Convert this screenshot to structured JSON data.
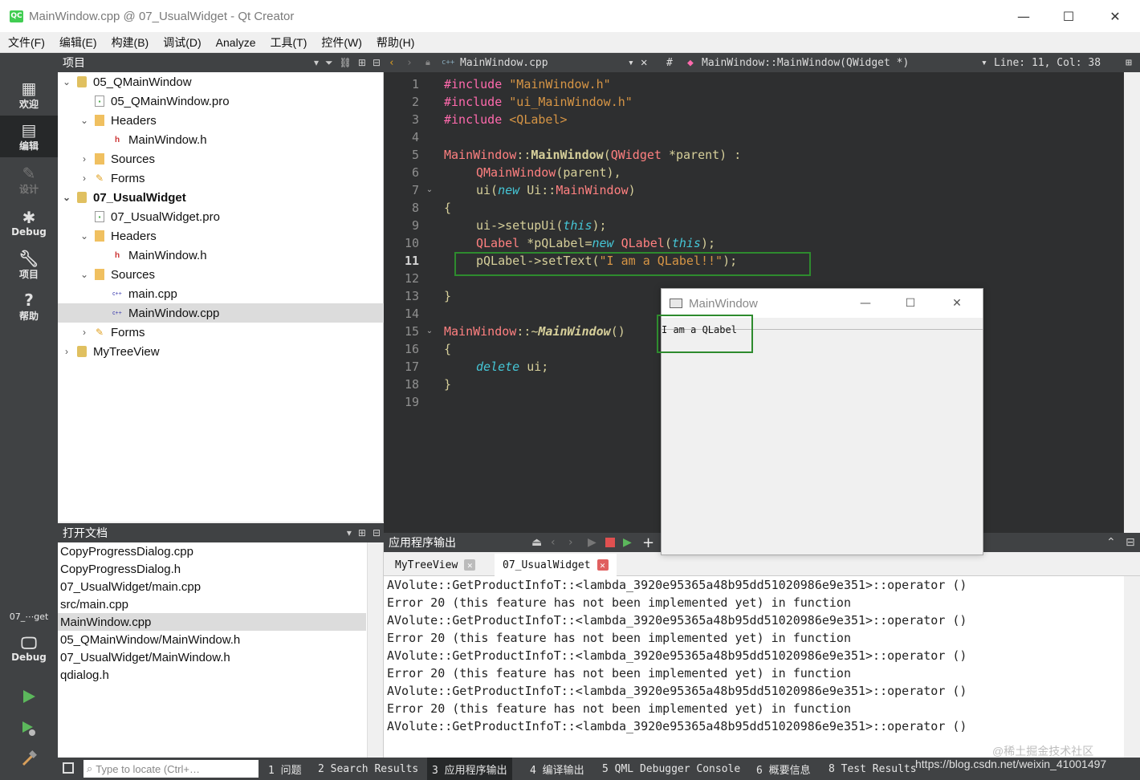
{
  "window": {
    "title": "MainWindow.cpp @ 07_UsualWidget - Qt Creator",
    "app_icon": "QC"
  },
  "menu": [
    "文件(F)",
    "编辑(E)",
    "构建(B)",
    "调试(D)",
    "Analyze",
    "工具(T)",
    "控件(W)",
    "帮助(H)"
  ],
  "modes": {
    "welcome": "欢迎",
    "edit": "编辑",
    "design": "设计",
    "debug": "Debug",
    "projects": "项目",
    "help": "帮助"
  },
  "kit": {
    "target": "07_⋯get",
    "mode": "Debug"
  },
  "projects_pane": {
    "title": "项目"
  },
  "tree": [
    {
      "label": "05_QMainWindow",
      "bold": false
    },
    {
      "label": "05_QMainWindow.pro"
    },
    {
      "label": "Headers"
    },
    {
      "label": "MainWindow.h"
    },
    {
      "label": "Sources"
    },
    {
      "label": "Forms"
    },
    {
      "label": "07_UsualWidget",
      "bold": true
    },
    {
      "label": "07_UsualWidget.pro"
    },
    {
      "label": "Headers"
    },
    {
      "label": "MainWindow.h"
    },
    {
      "label": "Sources"
    },
    {
      "label": "main.cpp"
    },
    {
      "label": "MainWindow.cpp",
      "selected": true
    },
    {
      "label": "Forms"
    },
    {
      "label": "MyTreeView"
    }
  ],
  "open_docs": {
    "title": "打开文档",
    "items": [
      "CopyProgressDialog.cpp",
      "CopyProgressDialog.h",
      "07_UsualWidget/main.cpp",
      "src/main.cpp",
      "MainWindow.cpp",
      "05_QMainWindow/MainWindow.h",
      "07_UsualWidget/MainWindow.h",
      "qdialog.h"
    ]
  },
  "editor_toolbar": {
    "file": "MainWindow.cpp",
    "hash": "#",
    "symbol": "MainWindow::MainWindow(QWidget *)",
    "position": "Line: 11, Col: 38"
  },
  "code_lines": [
    "1",
    "2",
    "3",
    "4",
    "5",
    "6",
    "7",
    "8",
    "9",
    "10",
    "11",
    "12",
    "13",
    "14",
    "15",
    "16",
    "17",
    "18",
    "19"
  ],
  "code": {
    "l1_pre": "#include",
    "l1_str": "\"MainWindow.h\"",
    "l2_pre": "#include",
    "l2_str": "\"ui_MainWindow.h\"",
    "l3_pre": "#include",
    "l3_str": "<QLabel>",
    "l5_cls": "MainWindow",
    "l5_sep": "::",
    "l5_fn": "MainWindow",
    "l5_p1": "(",
    "l5_type": "QWidget",
    "l5_rest": " *parent) :",
    "l6_cls": "QMainWindow",
    "l6_rest": "(parent),",
    "l7_a": "ui(",
    "l7_kw": "new",
    "l7_b": " Ui::",
    "l7_cls": "MainWindow",
    "l7_c": ")",
    "l8": "{",
    "l9_a": "ui->setupUi(",
    "l9_kw": "this",
    "l9_b": ");",
    "l10_cls": "QLabel",
    "l10_a": " *pQLabel=",
    "l10_kw": "new",
    "l10_cls2": " QLabel",
    "l10_b": "(",
    "l10_kw2": "this",
    "l10_c": ");",
    "l11_a": "pQLabel->setText(",
    "l11_str": "\"I am a QLabel!!\"",
    "l11_b": ");",
    "l13": "}",
    "l15_cls": "MainWindow",
    "l15_sep": "::~",
    "l15_fn": "MainWindow",
    "l15_rest": "()",
    "l16": "{",
    "l17_kw": "delete",
    "l17_rest": " ui;",
    "l18": "}"
  },
  "app_window": {
    "title": "MainWindow",
    "label": "I am a QLabel"
  },
  "output": {
    "title": "应用程序输出",
    "tabs": [
      {
        "label": "MyTreeView"
      },
      {
        "label": "07_UsualWidget"
      }
    ],
    "lines": [
      "AVolute::GetProductInfoT::<lambda_3920e95365a48b95dd51020986e9e351>::operator ()",
      "Error 20 (this feature has not been implemented yet) in function",
      "AVolute::GetProductInfoT::<lambda_3920e95365a48b95dd51020986e9e351>::operator ()",
      "Error 20 (this feature has not been implemented yet) in function",
      "AVolute::GetProductInfoT::<lambda_3920e95365a48b95dd51020986e9e351>::operator ()",
      "Error 20 (this feature has not been implemented yet) in function",
      "AVolute::GetProductInfoT::<lambda_3920e95365a48b95dd51020986e9e351>::operator ()",
      "Error 20 (this feature has not been implemented yet) in function",
      "AVolute::GetProductInfoT::<lambda_3920e95365a48b95dd51020986e9e351>::operator ()"
    ]
  },
  "statusbar": {
    "locate_placeholder": "Type to locate (Ctrl+…",
    "items": [
      "1 问题",
      "2 Search Results",
      "3 应用程序输出",
      "4 编译输出",
      "5 QML Debugger Console",
      "6 概要信息",
      "8 Test Results"
    ]
  },
  "watermark": {
    "line1": "@稀土掘金技术社区",
    "line2": "https://blog.csdn.net/weixin_41001497"
  },
  "colors": {
    "accent_green": "#2e8b2e",
    "editor_bg": "#2e2f30",
    "sidebar_bg": "#404244"
  }
}
